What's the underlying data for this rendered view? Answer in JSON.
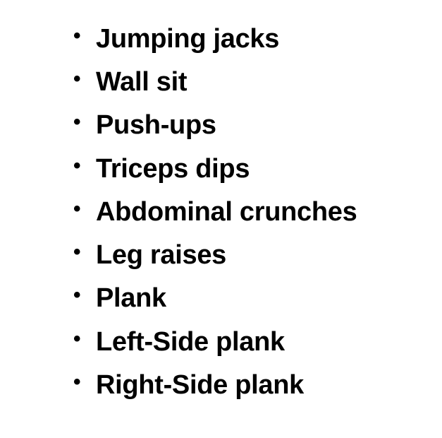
{
  "bullet_glyph": "•",
  "items": [
    "Jumping jacks",
    "Wall sit",
    "Push-ups",
    "Triceps dips",
    "Abdominal crunches",
    "Leg raises",
    "Plank",
    "Left-Side plank",
    "Right-Side plank"
  ]
}
